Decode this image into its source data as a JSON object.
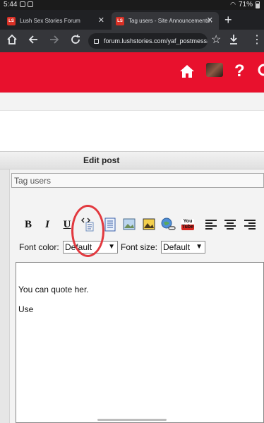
{
  "status_bar": {
    "time": "5:44",
    "battery": "71%"
  },
  "tabs": [
    {
      "title": "Lush Sex Stories Forum",
      "favicon": "LS",
      "active": false
    },
    {
      "title": "Tag users - Site Announcements / Fea",
      "favicon": "LS",
      "active": true
    }
  ],
  "toolbar": {
    "url": "forum.lushstories.com/yaf_postmessage"
  },
  "header_icons": [
    "home-icon",
    "avatar",
    "help-icon",
    "search-icon"
  ],
  "edit_post": {
    "title": "Edit post",
    "subject_value": "Tag users",
    "formatting": {
      "bold": "B",
      "italic": "I",
      "underline": "U",
      "buttons": [
        "code-icon",
        "quote-icon",
        "image-icon",
        "album-image-icon",
        "link-icon",
        "youtube-icon",
        "align-left-icon",
        "align-center-icon",
        "align-right-icon"
      ],
      "youtube_text": "You Tube"
    },
    "font_color_label": "Font color:",
    "font_color_value": "Default",
    "font_size_label": "Font size:",
    "font_size_value": "Default",
    "body_lines": [
      "You can quote her.",
      "Use"
    ]
  },
  "colors": {
    "brand_red": "#e8112d",
    "annotation_circle": "#e2393f"
  }
}
